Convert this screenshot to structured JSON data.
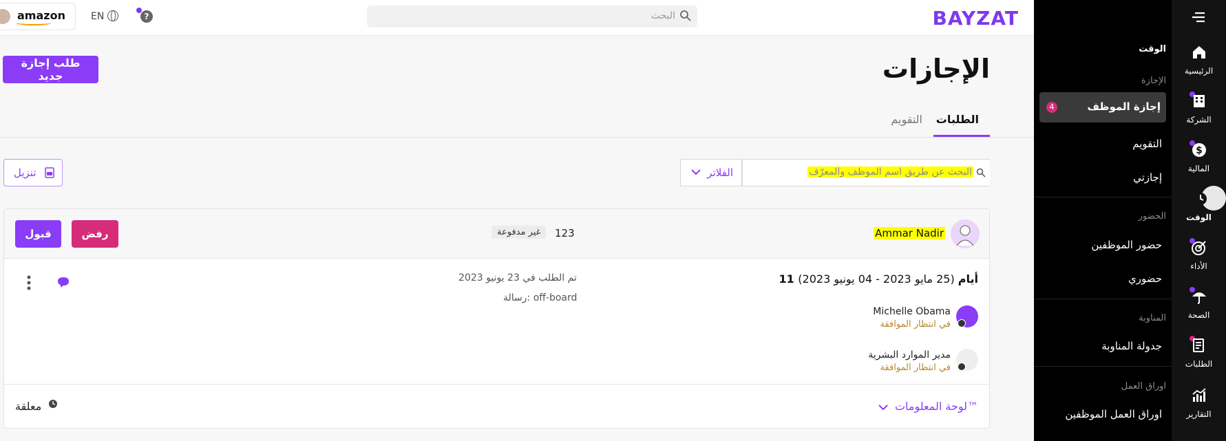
{
  "topbar": {
    "brand": "BAYZAT",
    "search_placeholder": "البحث",
    "account_logo": "amazon",
    "language": "EN",
    "help": "?"
  },
  "page": {
    "title": "الإجازات",
    "new_request_button": "طلب إجازة جديد",
    "tabs": [
      {
        "label": "الطلبات",
        "active": true
      },
      {
        "label": "التقويم",
        "active": false
      }
    ],
    "search_placeholder": "البحث عن طريق اسم الموظف والمعرّف",
    "filters_label": "الفلاتر",
    "download_label": "تنزيل"
  },
  "request": {
    "employee_name": "Ammar Nadir",
    "code": "123",
    "leave_type": "غير مدفوعة",
    "reject_label": "رفض",
    "accept_label": "قبول",
    "duration_bold": "11 أيام",
    "duration_range": " (25 مايو 2023 - 04 يونيو 2023)",
    "requested_on": "تم الطلب في 23 يونيو 2023",
    "message": "رسالة: off-board",
    "approvers": [
      {
        "name": "Michelle Obama",
        "status": "في انتظار الموافقة"
      },
      {
        "name": "مدير الموارد البشرية",
        "status": "في انتظار الموافقة"
      }
    ],
    "dashboard_link": "لوحة المعلومات™",
    "status": "معلقة"
  },
  "subnav": {
    "section_time": "الوقت",
    "groups": [
      {
        "heading": "الإجازة",
        "items": [
          "إجازة الموظف",
          "التقويم",
          "إجازتي"
        ]
      },
      {
        "heading": "الحضور",
        "items": [
          "حضور الموظفين",
          "حضوري"
        ]
      },
      {
        "heading": "المناوبة",
        "items": [
          "جدولة المناوبة"
        ]
      },
      {
        "heading": "اوراق العمل",
        "items": [
          "اوراق العمل الموظفين"
        ]
      }
    ],
    "active_badge": "4"
  },
  "rail": {
    "items": [
      {
        "label": "الرئيسية",
        "icon": "home-icon"
      },
      {
        "label": "الشركة",
        "icon": "building-icon"
      },
      {
        "label": "المالية",
        "icon": "dollar-icon"
      },
      {
        "label": "الوقت",
        "icon": "clock-icon"
      },
      {
        "label": "الأداء",
        "icon": "target-icon"
      },
      {
        "label": "الصحة",
        "icon": "umbrella-icon"
      },
      {
        "label": "الطلبات",
        "icon": "clipboard-icon"
      },
      {
        "label": "التقارير",
        "icon": "chart-icon"
      }
    ]
  },
  "colors": {
    "accent": "#8b3cf7",
    "danger": "#d72c7a",
    "sidebar": "#000000",
    "rail": "#131313",
    "highlight": "#ffff00",
    "pending": "#b8862b"
  }
}
